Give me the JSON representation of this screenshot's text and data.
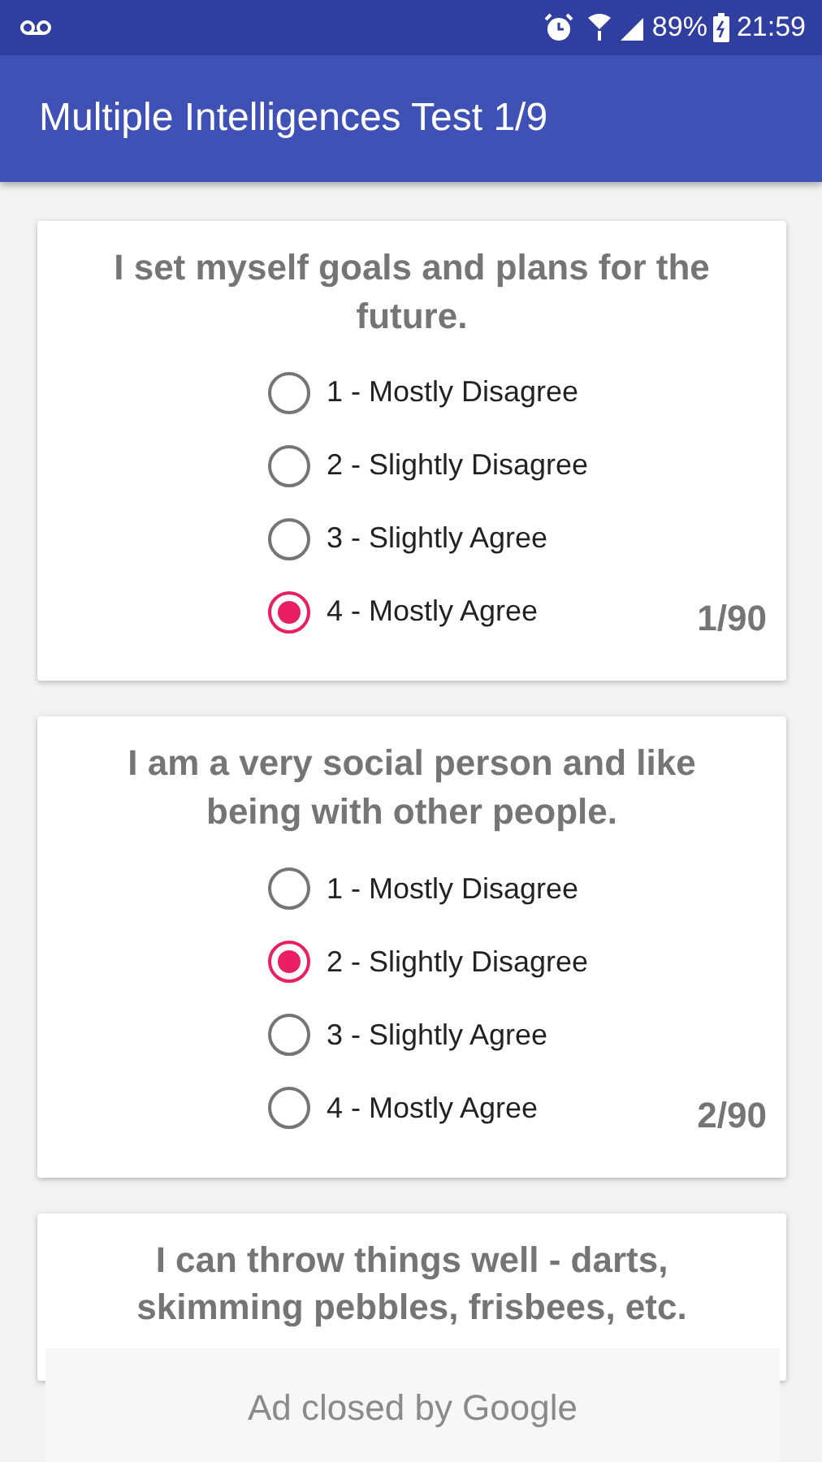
{
  "status_bar": {
    "battery": "89%",
    "time": "21:59"
  },
  "app_bar": {
    "title": "Multiple Intelligences Test 1/9"
  },
  "questions": [
    {
      "text": "I set myself goals and plans for the future.",
      "counter": "1/90",
      "options": [
        {
          "label": "1 - Mostly Disagree",
          "selected": false
        },
        {
          "label": "2 - Slightly Disagree",
          "selected": false
        },
        {
          "label": "3 - Slightly Agree",
          "selected": false
        },
        {
          "label": "4 - Mostly Agree",
          "selected": true
        }
      ]
    },
    {
      "text": "I am a very social person and like being with other people.",
      "counter": "2/90",
      "options": [
        {
          "label": "1 - Mostly Disagree",
          "selected": false
        },
        {
          "label": "2 - Slightly Disagree",
          "selected": true
        },
        {
          "label": "3 - Slightly Agree",
          "selected": false
        },
        {
          "label": "4 - Mostly Agree",
          "selected": false
        }
      ]
    },
    {
      "text": "I can throw things well - darts, skimming pebbles, frisbees, etc."
    }
  ],
  "ad_banner": {
    "text": "Ad closed by Google"
  }
}
